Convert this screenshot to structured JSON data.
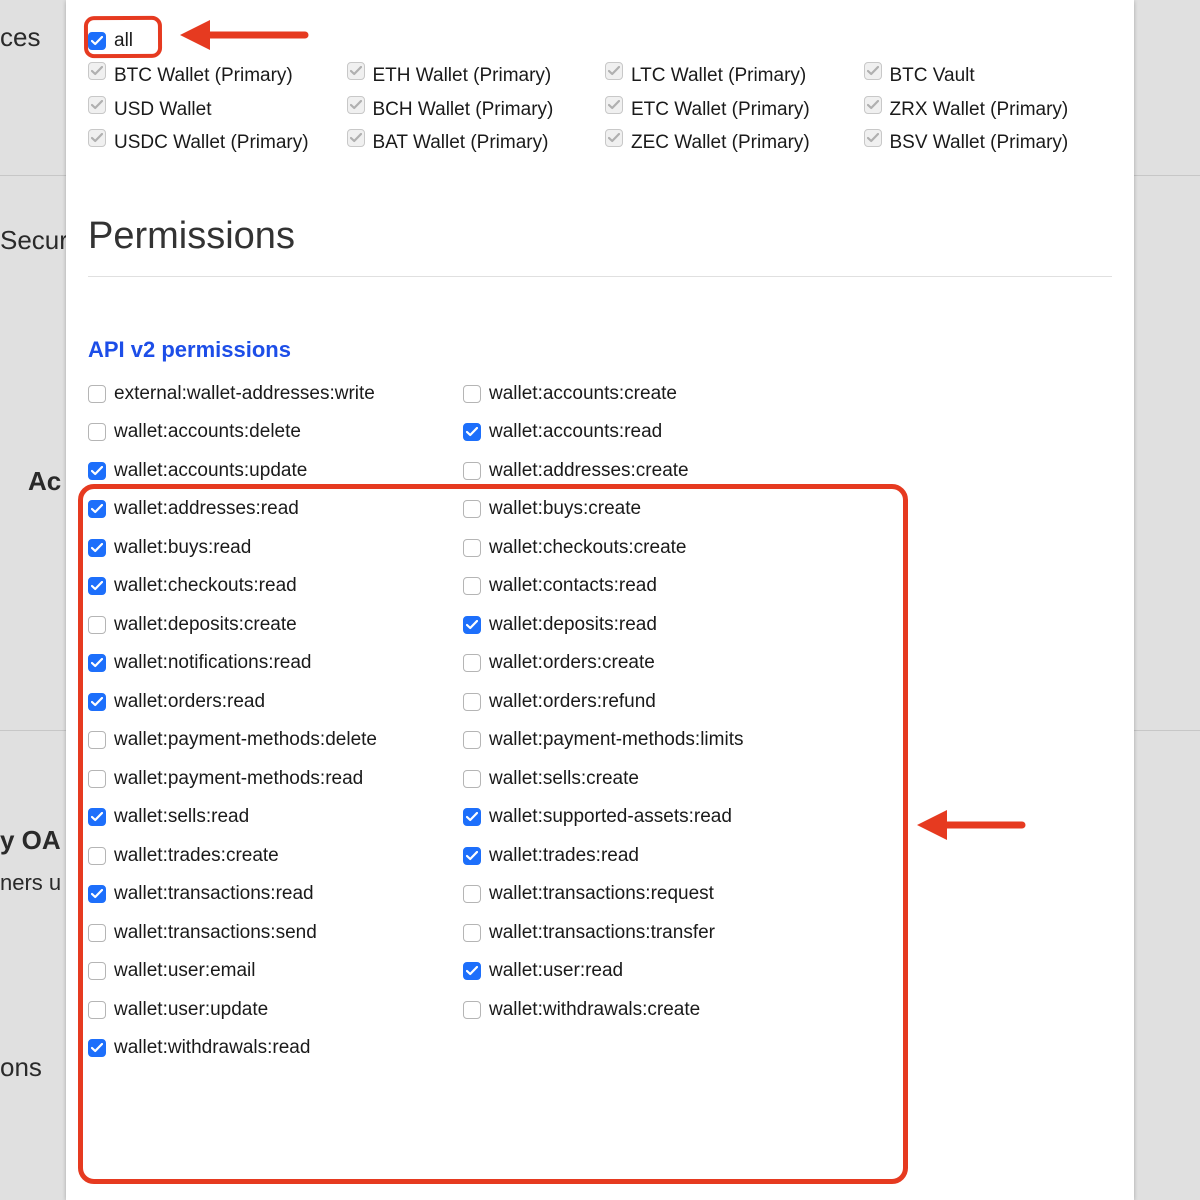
{
  "background": {
    "ces": "ces",
    "securi": "Securi",
    "ac": "Ac",
    "oauth": "y OA",
    "ners": "ners u",
    "ons": "ons"
  },
  "accounts": {
    "all_label": "all",
    "items": [
      {
        "label": "BTC Wallet (Primary)"
      },
      {
        "label": "ETH Wallet (Primary)"
      },
      {
        "label": "LTC Wallet (Primary)"
      },
      {
        "label": "BTC Vault"
      },
      {
        "label": "USD Wallet"
      },
      {
        "label": "BCH Wallet (Primary)"
      },
      {
        "label": "ETC Wallet (Primary)"
      },
      {
        "label": "ZRX Wallet (Primary)"
      },
      {
        "label": "USDC Wallet (Primary)"
      },
      {
        "label": "BAT Wallet (Primary)"
      },
      {
        "label": "ZEC Wallet (Primary)"
      },
      {
        "label": "BSV Wallet (Primary)"
      }
    ]
  },
  "permissions_title": "Permissions",
  "api_v2_title": "API v2 permissions",
  "permissions": [
    {
      "label": "external:wallet-addresses:write",
      "checked": false
    },
    {
      "label": "wallet:accounts:create",
      "checked": false
    },
    {
      "label": "wallet:accounts:delete",
      "checked": false
    },
    {
      "label": "wallet:accounts:read",
      "checked": true
    },
    {
      "label": "wallet:accounts:update",
      "checked": true
    },
    {
      "label": "wallet:addresses:create",
      "checked": false
    },
    {
      "label": "wallet:addresses:read",
      "checked": true
    },
    {
      "label": "wallet:buys:create",
      "checked": false
    },
    {
      "label": "wallet:buys:read",
      "checked": true
    },
    {
      "label": "wallet:checkouts:create",
      "checked": false
    },
    {
      "label": "wallet:checkouts:read",
      "checked": true
    },
    {
      "label": "wallet:contacts:read",
      "checked": false
    },
    {
      "label": "wallet:deposits:create",
      "checked": false
    },
    {
      "label": "wallet:deposits:read",
      "checked": true
    },
    {
      "label": "wallet:notifications:read",
      "checked": true
    },
    {
      "label": "wallet:orders:create",
      "checked": false
    },
    {
      "label": "wallet:orders:read",
      "checked": true
    },
    {
      "label": "wallet:orders:refund",
      "checked": false
    },
    {
      "label": "wallet:payment-methods:delete",
      "checked": false
    },
    {
      "label": "wallet:payment-methods:limits",
      "checked": false
    },
    {
      "label": "wallet:payment-methods:read",
      "checked": false
    },
    {
      "label": "wallet:sells:create",
      "checked": false
    },
    {
      "label": "wallet:sells:read",
      "checked": true
    },
    {
      "label": "wallet:supported-assets:read",
      "checked": true
    },
    {
      "label": "wallet:trades:create",
      "checked": false
    },
    {
      "label": "wallet:trades:read",
      "checked": true
    },
    {
      "label": "wallet:transactions:read",
      "checked": true
    },
    {
      "label": "wallet:transactions:request",
      "checked": false
    },
    {
      "label": "wallet:transactions:send",
      "checked": false
    },
    {
      "label": "wallet:transactions:transfer",
      "checked": false
    },
    {
      "label": "wallet:user:email",
      "checked": false
    },
    {
      "label": "wallet:user:read",
      "checked": true
    },
    {
      "label": "wallet:user:update",
      "checked": false
    },
    {
      "label": "wallet:withdrawals:create",
      "checked": false
    },
    {
      "label": "wallet:withdrawals:read",
      "checked": true
    }
  ],
  "annotations": {
    "color": "#e63a20"
  }
}
